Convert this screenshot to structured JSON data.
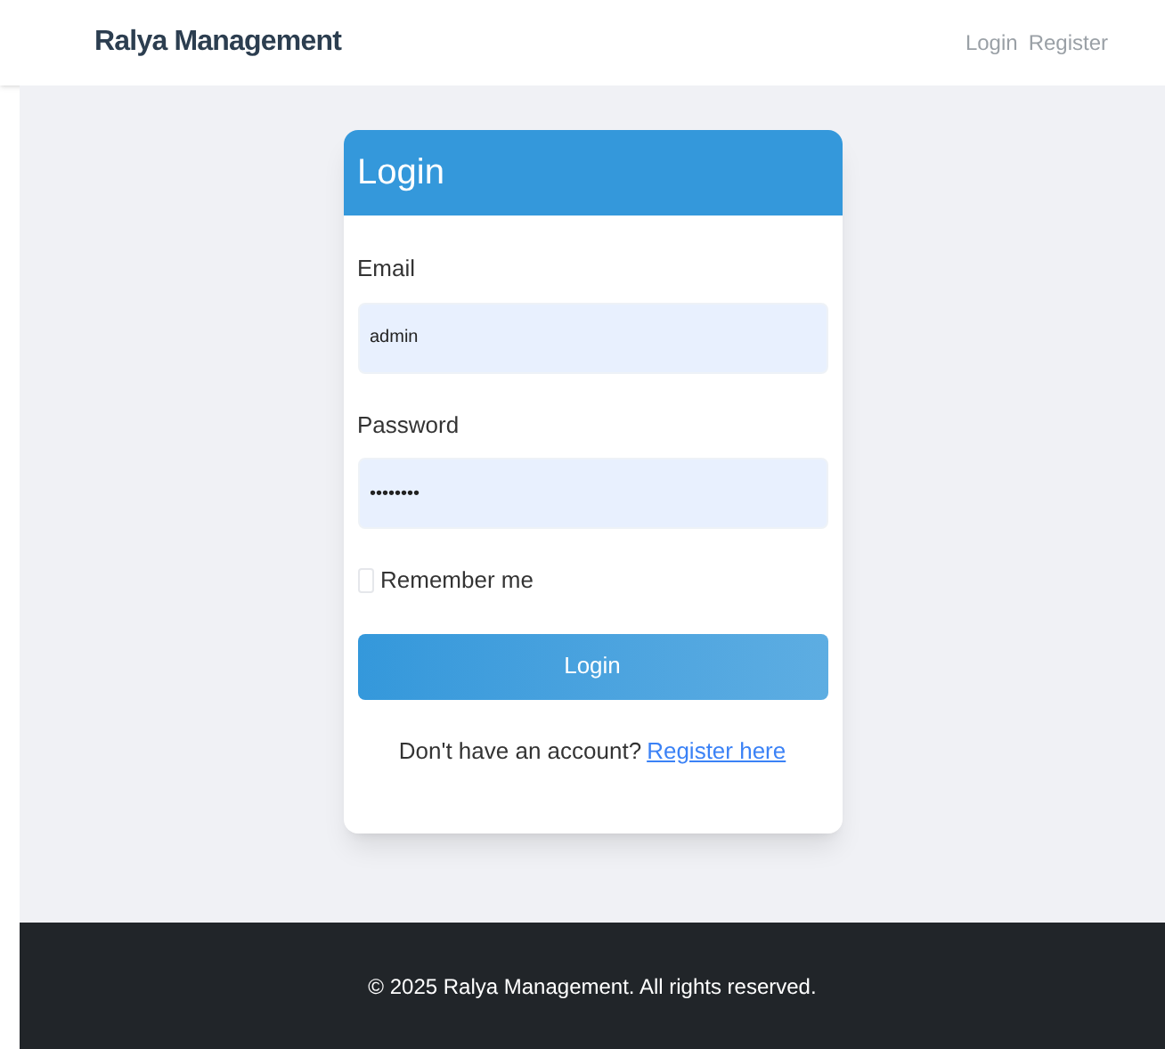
{
  "navbar": {
    "brand": "Ralya Management",
    "links": [
      {
        "label": "Login"
      },
      {
        "label": "Register"
      }
    ]
  },
  "login_card": {
    "title": "Login",
    "fields": [
      {
        "label": "Email",
        "value": "admin"
      },
      {
        "label": "Password",
        "value": "••••••••"
      }
    ],
    "remember_me": {
      "label": "Remember me",
      "checked": false
    },
    "submit_button": "Login",
    "register_prompt": {
      "text": "Don't have an account?",
      "link": "Register here"
    }
  },
  "footer": {
    "text": "© 2025 Ralya Management. All rights reserved."
  }
}
